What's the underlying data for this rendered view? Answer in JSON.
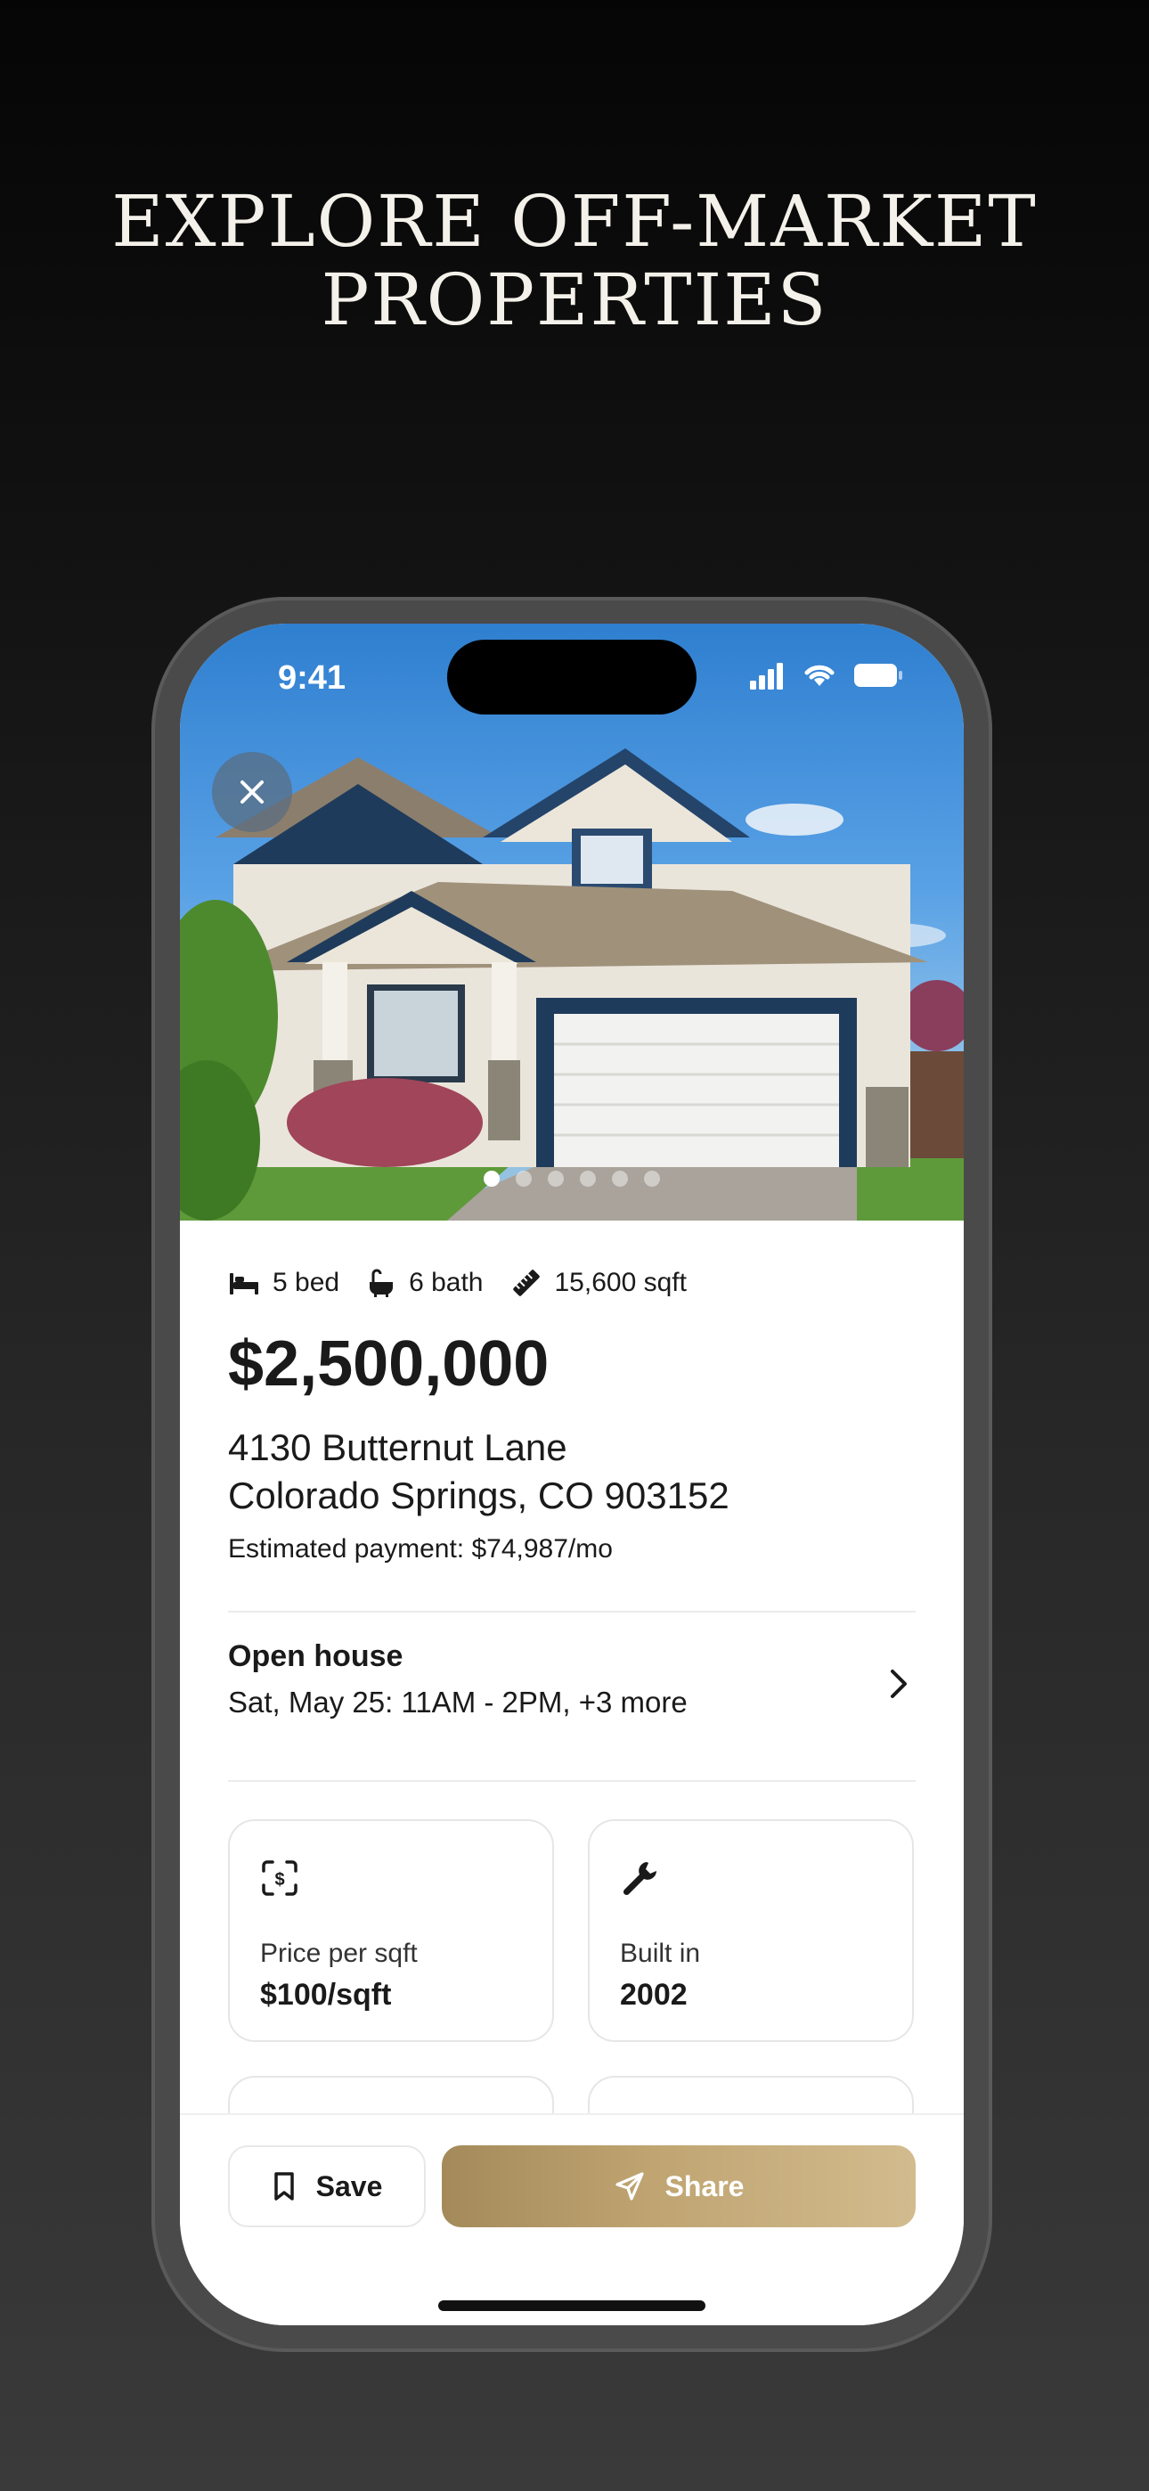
{
  "headline": {
    "line1": "EXPLORE OFF-MARKET",
    "line2": "PROPERTIES"
  },
  "status_bar": {
    "time": "9:41"
  },
  "gallery": {
    "photo_count": 6,
    "active_index": 0
  },
  "listing": {
    "beds": "5 bed",
    "baths": "6 bath",
    "sqft": "15,600 sqft",
    "price": "$2,500,000",
    "address_line1": "4130 Butternut Lane",
    "address_line2": "Colorado Springs, CO 903152",
    "estimated_payment": "Estimated payment: $74,987/mo"
  },
  "open_house": {
    "title": "Open house",
    "schedule": "Sat, May 25: 11AM - 2PM, +3 more"
  },
  "facts": [
    {
      "icon": "dollar-scan-icon",
      "label": "Price per sqft",
      "value": "$100/sqft"
    },
    {
      "icon": "wrench-icon",
      "label": "Built in",
      "value": "2002"
    }
  ],
  "actions": {
    "save_label": "Save",
    "share_label": "Share"
  },
  "colors": {
    "share_gradient_start": "#a48a5a",
    "share_gradient_end": "#d2bb8e",
    "background": "#0a0a0a"
  }
}
